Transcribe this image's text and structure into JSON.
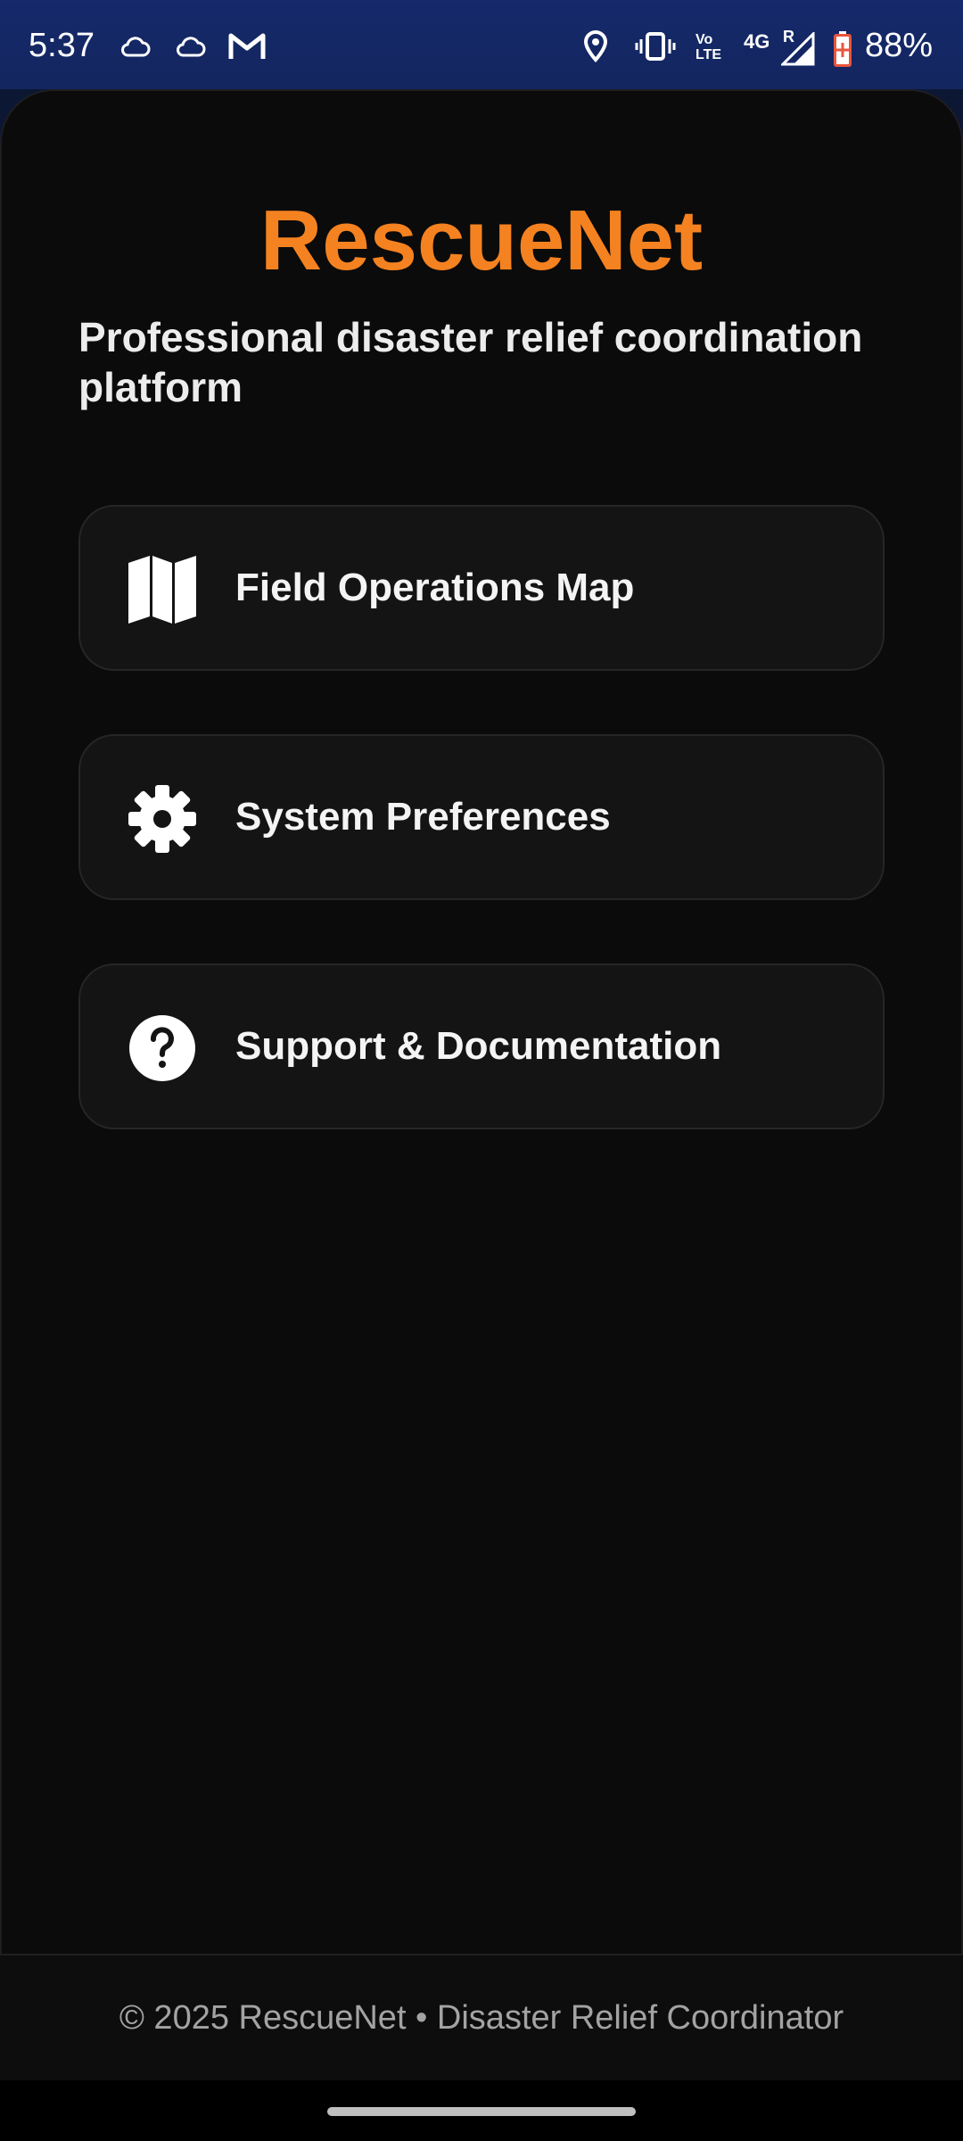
{
  "status_bar": {
    "time": "5:37",
    "network_volte": "Vo LTE",
    "network_4g": "4G",
    "roaming": "R",
    "battery": "88%"
  },
  "app": {
    "title": "RescueNet",
    "subtitle": "Professional disaster relief coordination platform",
    "accent_color": "#f58220"
  },
  "menu": [
    {
      "label": "Field Operations Map",
      "icon": "map-icon"
    },
    {
      "label": "System Preferences",
      "icon": "gear-icon"
    },
    {
      "label": "Support & Documentation",
      "icon": "help-icon"
    }
  ],
  "footer": {
    "text": "© 2025 RescueNet • Disaster Relief Coordinator"
  }
}
